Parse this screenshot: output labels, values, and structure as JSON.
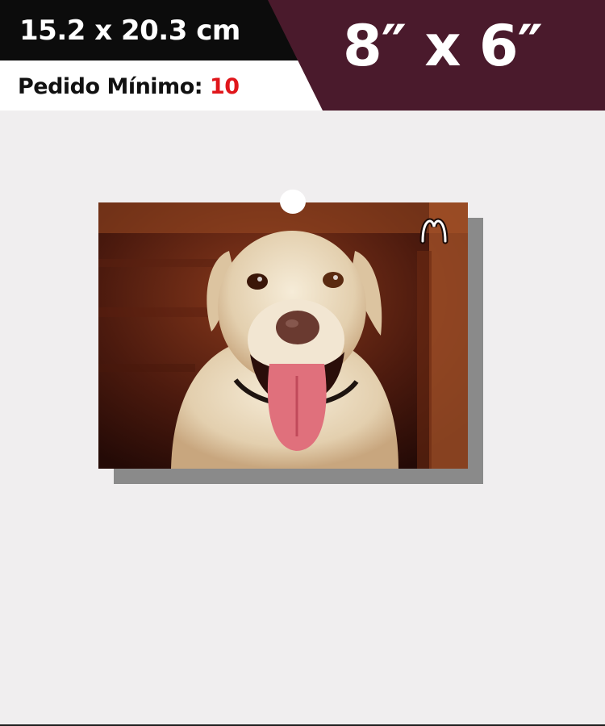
{
  "header": {
    "size_cm": "15.2 x 20.3 cm",
    "min_order_label": "Pedido Mínimo:",
    "min_order_qty": "10",
    "size_in": "8″ x 6″"
  },
  "colors": {
    "band_black": "#0c0c0c",
    "band_maroon": "#4a1a2c",
    "page_bg": "#f0eeef",
    "min_qty_red": "#e0161b"
  },
  "product": {
    "subject": "smiling white labrador dog photo print",
    "icon": "brand-logo-icon"
  }
}
